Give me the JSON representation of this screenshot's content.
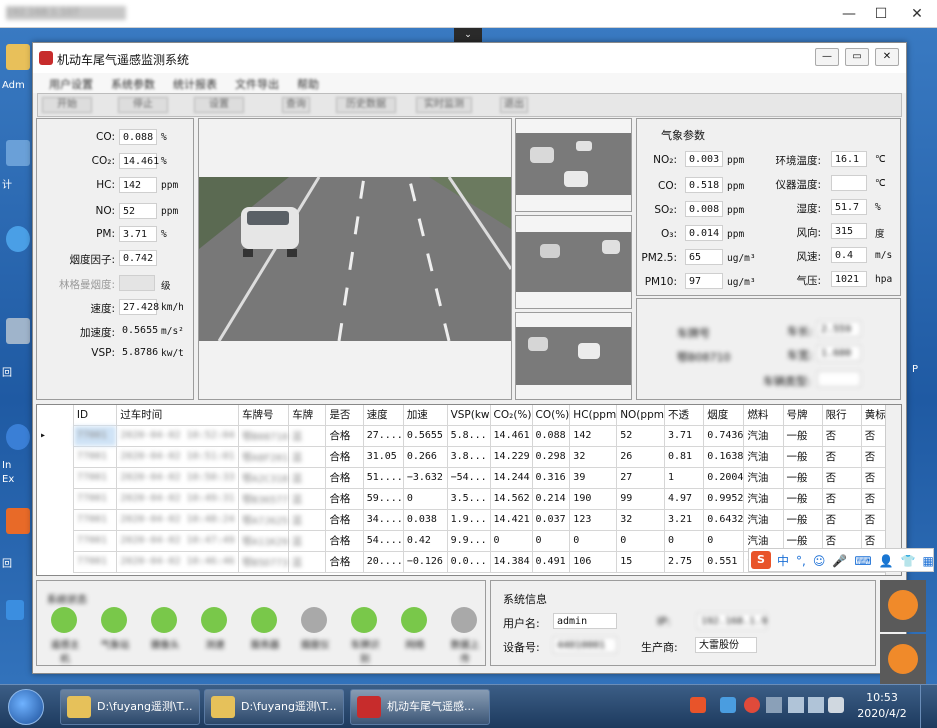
{
  "remote": {
    "title": "192.168.1.107",
    "tab": "⌄"
  },
  "desktop": {
    "icons": [
      "Adm",
      "计",
      "",
      "回",
      "In",
      "Ex",
      "回"
    ],
    "right_label": "P"
  },
  "app": {
    "title": "机动车尾气遥感监测系统",
    "menu": [
      "用户设置",
      "系统参数",
      "统计报表",
      "文件导出",
      "帮助"
    ],
    "toolbar": [
      "开始",
      "停止",
      "设置",
      "查询",
      "历史数据",
      "实时监测",
      "退出"
    ]
  },
  "measurements": {
    "rows": [
      {
        "label": "CO:",
        "value": "0.088",
        "unit": "%"
      },
      {
        "label": "CO₂:",
        "value": "14.461",
        "unit": "%"
      },
      {
        "label": "HC:",
        "value": "142",
        "unit": "ppm"
      },
      {
        "label": "NO:",
        "value": "52",
        "unit": "ppm"
      },
      {
        "label": "PM:",
        "value": "3.71",
        "unit": "%"
      },
      {
        "label": "烟度因子:",
        "value": "0.742",
        "unit": ""
      },
      {
        "label": "林格曼烟度:",
        "value": "",
        "unit": "级"
      },
      {
        "label": "速度:",
        "value": "27.428",
        "unit": "km/h"
      },
      {
        "label": "加速度:",
        "value": "0.5655",
        "unit": "m/s²"
      },
      {
        "label": "VSP:",
        "value": "5.8786",
        "unit": "kw/t"
      }
    ]
  },
  "weather": {
    "title": "气象参数",
    "left": [
      {
        "label": "NO₂:",
        "value": "0.003",
        "unit": "ppm"
      },
      {
        "label": "CO:",
        "value": "0.518",
        "unit": "ppm"
      },
      {
        "label": "SO₂:",
        "value": "0.008",
        "unit": "ppm"
      },
      {
        "label": "O₃:",
        "value": "0.014",
        "unit": "ppm"
      },
      {
        "label": "PM2.5:",
        "value": "65",
        "unit": "ug/m³"
      },
      {
        "label": "PM10:",
        "value": "97",
        "unit": "ug/m³"
      }
    ],
    "right": [
      {
        "label": "环境温度:",
        "value": "16.1",
        "unit": "℃"
      },
      {
        "label": "仪器温度:",
        "value": "",
        "unit": "℃"
      },
      {
        "label": "湿度:",
        "value": "51.7",
        "unit": "%"
      },
      {
        "label": "风向:",
        "value": "315",
        "unit": "度"
      },
      {
        "label": "风速:",
        "value": "0.4",
        "unit": "m/s"
      },
      {
        "label": "气压:",
        "value": "1021",
        "unit": "hpa"
      }
    ]
  },
  "plate_panel": {
    "plate_label": "车牌号",
    "plate": "鄂B08710",
    "labels": [
      "车长:",
      "车宽:",
      "车辆类型:"
    ],
    "values": [
      "2.559",
      "1.600",
      ""
    ]
  },
  "table": {
    "headers": [
      "ID",
      "过车时间",
      "车牌号",
      "车牌",
      "是否",
      "速度",
      "加速",
      "VSP(kw",
      "CO₂(%)",
      "CO(%)",
      "HC(ppm",
      "NO(ppm",
      "不透",
      "烟度",
      "燃料",
      "号牌",
      "限行",
      "黄标"
    ],
    "rows": [
      [
        "77001",
        "2020-04-02 10:52:04",
        "鄂B08710",
        "蓝",
        "合格",
        "27....",
        "0.5655",
        "5.8...",
        "14.461",
        "0.088",
        "142",
        "52",
        "3.71",
        "0.7436",
        "汽油",
        "一般",
        "否",
        "否"
      ],
      [
        "77001",
        "2020-04-02 10:51:01",
        "鄂A8F201",
        "蓝",
        "合格",
        "31.05",
        "0.266",
        "3.8...",
        "14.229",
        "0.298",
        "32",
        "26",
        "0.81",
        "0.1638",
        "汽油",
        "一般",
        "否",
        "否"
      ],
      [
        "77001",
        "2020-04-02 10:50:33",
        "鄂A2C318",
        "蓝",
        "合格",
        "51....",
        "−3.632",
        "−54...",
        "14.244",
        "0.316",
        "39",
        "27",
        "1",
        "0.2004",
        "汽油",
        "一般",
        "否",
        "否"
      ],
      [
        "77001",
        "2020-04-02 10:49:31",
        "鄂B36577",
        "蓝",
        "合格",
        "59....",
        "0",
        "3.5...",
        "14.562",
        "0.214",
        "190",
        "99",
        "4.97",
        "0.9952",
        "汽油",
        "一般",
        "否",
        "否"
      ],
      [
        "77001",
        "2020-04-02 10:48:24",
        "鄂A7J625",
        "蓝",
        "合格",
        "34....",
        "0.038",
        "1.9...",
        "14.421",
        "0.037",
        "123",
        "32",
        "3.21",
        "0.6432",
        "汽油",
        "一般",
        "否",
        "否"
      ],
      [
        "77001",
        "2020-04-02 10:47:49",
        "鄂A11K29",
        "蓝",
        "合格",
        "54....",
        "0.42",
        "9.9...",
        "0",
        "0",
        "0",
        "0",
        "0",
        "0",
        "汽油",
        "一般",
        "否",
        "否"
      ],
      [
        "77001",
        "2020-04-02 10:46:46",
        "鄂B5D773",
        "蓝",
        "合格",
        "20....",
        "−0.126",
        "0.0...",
        "14.384",
        "0.491",
        "106",
        "15",
        "2.75",
        "0.551",
        "汽油",
        "一般",
        "否",
        "否"
      ]
    ]
  },
  "status": {
    "title": "系统状态",
    "items": [
      "遥感主机",
      "气象站",
      "摄像头",
      "测速",
      "服务器",
      "烟度仪",
      "车牌识别",
      "网络",
      "数据上传"
    ],
    "colors": [
      "#79c84a",
      "#79c84a",
      "#79c84a",
      "#79c84a",
      "#79c84a",
      "#a9a9a9",
      "#79c84a",
      "#79c84a",
      "#a9a9a9"
    ]
  },
  "sysinfo": {
    "title": "系统信息",
    "user_label": "用户名:",
    "user": "admin",
    "device_label": "设备号:",
    "device": "44010001",
    "maker_label": "生产商:",
    "maker": "大雷股份",
    "ip_label": "IP:",
    "ip": "192.168.1.9"
  },
  "ime": {
    "logo": "S",
    "items": [
      "中",
      "°,",
      "☺",
      "🎤",
      "⌨",
      "👤",
      "👕",
      "▦"
    ]
  },
  "taskbar": {
    "items": [
      "D:\\fuyang遥测\\T...",
      "D:\\fuyang遥测\\T...",
      "机动车尾气遥感..."
    ],
    "time": "10:53",
    "date": "2020/4/2"
  },
  "colors": {
    "accent_red": "#d6322b",
    "status_green": "#79c84a",
    "status_gray": "#a9a9a9"
  }
}
